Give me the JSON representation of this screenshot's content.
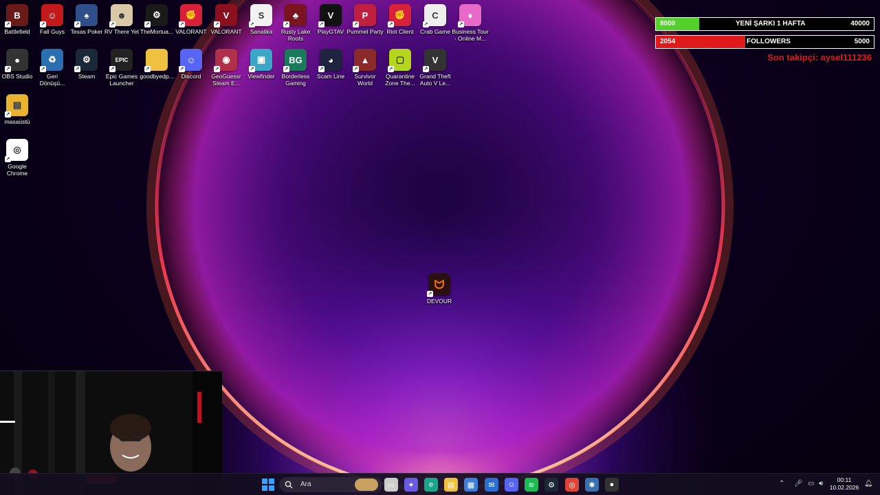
{
  "desktop_icons": [
    {
      "label": "Battlefield",
      "color": "#6b1a1a",
      "glyph": "B"
    },
    {
      "label": "Fall Guys",
      "color": "#c21a1a",
      "glyph": "☺"
    },
    {
      "label": "Texas Poker",
      "color": "#2f4f8a",
      "glyph": "♠"
    },
    {
      "label": "RV There Yet",
      "color": "#d9c9a8",
      "glyph": "☻"
    },
    {
      "label": "TheMortua...",
      "color": "#1a1a1a",
      "glyph": "⚙"
    },
    {
      "label": "VALORANT",
      "color": "#d9203a",
      "glyph": "✊"
    },
    {
      "label": "VALORANT",
      "color": "#8a1020",
      "glyph": "V"
    },
    {
      "label": "Sanalika",
      "color": "#f2f2f2",
      "glyph": "S"
    },
    {
      "label": "Rusty Lake Roots",
      "color": "#7a1520",
      "glyph": "♣"
    },
    {
      "label": "PlayGTAV",
      "color": "#111",
      "glyph": "V"
    },
    {
      "label": "Pummel Party",
      "color": "#c02040",
      "glyph": "P"
    },
    {
      "label": "Riot Client",
      "color": "#d9203a",
      "glyph": "✊"
    },
    {
      "label": "Crab Game",
      "color": "#eee",
      "glyph": "C"
    },
    {
      "label": "Business Tour - Online M...",
      "color": "#e86ac8",
      "glyph": "♦"
    },
    {
      "label": "OBS Studio",
      "color": "#333",
      "glyph": "●"
    },
    {
      "label": "Geri Dönüşü...",
      "color": "#2a6fb0",
      "glyph": "♻"
    },
    {
      "label": "Steam",
      "color": "#1b2838",
      "glyph": "⚙"
    },
    {
      "label": "Epic Games Launcher",
      "color": "#222",
      "glyph": "EPIC"
    },
    {
      "label": "goodbyedp...",
      "color": "#f0c040",
      "glyph": ""
    },
    {
      "label": "Discord",
      "color": "#5865f2",
      "glyph": "☺"
    },
    {
      "label": "GeoGuessr Steam E...",
      "color": "#b0304a",
      "glyph": "◉"
    },
    {
      "label": "Viewfinder",
      "color": "#3aa6c8",
      "glyph": "▣"
    },
    {
      "label": "Borderless Gaming",
      "color": "#1c7a5c",
      "glyph": "BG"
    },
    {
      "label": "Scam Line",
      "color": "#1e2440",
      "glyph": "◕"
    },
    {
      "label": "Survivor World",
      "color": "#8a2a2a",
      "glyph": "▲"
    },
    {
      "label": "Quarantine Zone The...",
      "color": "#b6d61e",
      "glyph": "▢"
    },
    {
      "label": "Grand Theft Auto V Le...",
      "color": "#333",
      "glyph": "V"
    },
    {
      "label": "masaüstü",
      "color": "#e8b430",
      "glyph": "▤"
    },
    {
      "label": "Google Chrome",
      "color": "#fff",
      "glyph": "◎"
    }
  ],
  "devour_icon": {
    "label": "DEVOUR",
    "color": "#2a1010",
    "glyph": "ᗢ"
  },
  "overlay": {
    "song_goal": {
      "current": "8000",
      "label": "YENİ ŞARKI 1 HAFTA",
      "target": "40000",
      "fill": 0.2,
      "color": "#52d12a"
    },
    "followers_goal": {
      "current": "2054",
      "label": "FOLLOWERS",
      "target": "5000",
      "fill": 0.41,
      "color": "#e0191b"
    },
    "last_follower": "Son takipçi: aysel111236"
  },
  "taskbar": {
    "search_placeholder": "Ara",
    "time": "00:11",
    "date": "10.02.2026",
    "apps": [
      {
        "name": "file-explorer-window-icon",
        "color": "#ccc",
        "glyph": "▭"
      },
      {
        "name": "copilot-icon",
        "color": "#6a5ae0",
        "glyph": "✦"
      },
      {
        "name": "edge-icon",
        "color": "#1aa58c",
        "glyph": "e"
      },
      {
        "name": "folder-icon",
        "color": "#f0c040",
        "glyph": "▤"
      },
      {
        "name": "store-icon",
        "color": "#3b7fd9",
        "glyph": "▦"
      },
      {
        "name": "mail-icon",
        "color": "#2a6fd0",
        "glyph": "✉"
      },
      {
        "name": "discord-icon",
        "color": "#5865f2",
        "glyph": "☺"
      },
      {
        "name": "spotify-icon",
        "color": "#1db954",
        "glyph": "≋"
      },
      {
        "name": "steam-icon",
        "color": "#1b2838",
        "glyph": "⚙"
      },
      {
        "name": "chrome-icon",
        "color": "#db4437",
        "glyph": "◎"
      },
      {
        "name": "settings-app-icon",
        "color": "#3a6fb0",
        "glyph": "✱"
      },
      {
        "name": "obs-icon",
        "color": "#333",
        "glyph": "●"
      }
    ]
  }
}
